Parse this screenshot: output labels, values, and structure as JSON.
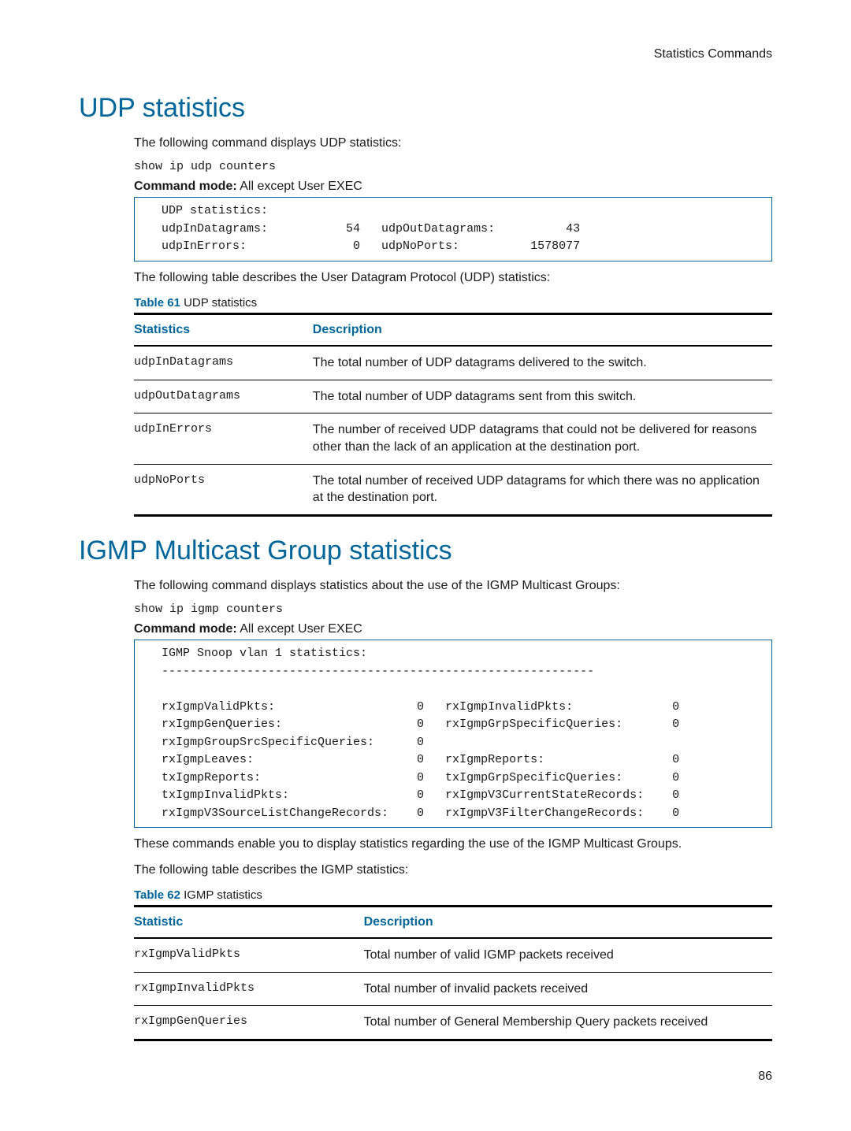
{
  "header": {
    "right": "Statistics Commands"
  },
  "udp": {
    "title": "UDP statistics",
    "intro": "The following command displays UDP statistics:",
    "command": "show ip udp counters",
    "cmd_mode_label": "Command mode:",
    "cmd_mode_value": " All except User EXEC",
    "output": "UDP statistics:\nudpInDatagrams:           54   udpOutDatagrams:          43\nudpInErrors:               0   udpNoPorts:          1578077",
    "after_output": "The following table describes the User Datagram Protocol (UDP) statistics:",
    "table_label": "Table 61",
    "table_title": " UDP statistics",
    "th_stat": "Statistics",
    "th_desc": "Description",
    "rows": [
      {
        "stat": "udpInDatagrams",
        "desc": "The total number of UDP datagrams delivered to the switch."
      },
      {
        "stat": "udpOutDatagrams",
        "desc": "The total number of UDP datagrams sent from this switch."
      },
      {
        "stat": "udpInErrors",
        "desc": "The number of received UDP datagrams that could not be delivered for reasons other than the lack of an application at the destination port."
      },
      {
        "stat": "udpNoPorts",
        "desc": "The total number of received UDP datagrams for which there was no application at the destination port."
      }
    ]
  },
  "igmp": {
    "title": "IGMP Multicast Group statistics",
    "intro": "The following command displays statistics about the use of the IGMP Multicast Groups:",
    "command": "show ip igmp counters",
    "cmd_mode_label": "Command mode:",
    "cmd_mode_value": " All except User EXEC",
    "output": "IGMP Snoop vlan 1 statistics:\n-------------------------------------------------------------\n\nrxIgmpValidPkts:                    0   rxIgmpInvalidPkts:              0\nrxIgmpGenQueries:                   0   rxIgmpGrpSpecificQueries:       0\nrxIgmpGroupSrcSpecificQueries:      0\nrxIgmpLeaves:                       0   rxIgmpReports:                  0\ntxIgmpReports:                      0   txIgmpGrpSpecificQueries:       0\ntxIgmpInvalidPkts:                  0   rxIgmpV3CurrentStateRecords:    0\nrxIgmpV3SourceListChangeRecords:    0   rxIgmpV3FilterChangeRecords:    0",
    "after1": "These commands enable you to display statistics regarding the use of the IGMP Multicast Groups.",
    "after2": "The following table describes the IGMP statistics:",
    "table_label": "Table 62",
    "table_title": " IGMP statistics",
    "th_stat": "Statistic",
    "th_desc": "Description",
    "rows": [
      {
        "stat": "rxIgmpValidPkts",
        "desc": "Total number of valid IGMP packets received"
      },
      {
        "stat": "rxIgmpInvalidPkts",
        "desc": "Total number of invalid packets received"
      },
      {
        "stat": "rxIgmpGenQueries",
        "desc": "Total number of General Membership Query packets received"
      }
    ]
  },
  "page_number": "86"
}
